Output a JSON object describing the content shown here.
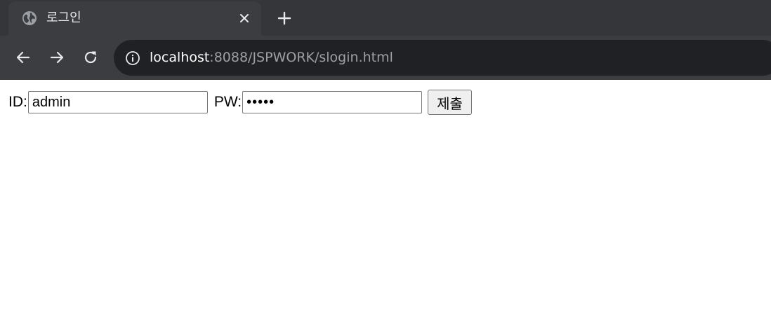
{
  "browser": {
    "tab": {
      "title": "로그인",
      "favicon": "globe-icon",
      "close": "close-icon"
    },
    "new_tab": "plus-icon",
    "toolbar": {
      "back": "arrow-left-icon",
      "forward": "arrow-right-icon",
      "reload": "reload-icon",
      "site_info": "info-icon",
      "url_host": "localhost",
      "url_rest": ":8088/JSPWORK/slogin.html"
    },
    "colors": {
      "tabstrip": "#35363a",
      "toolbar": "#3c3d40",
      "omnibox": "#202124",
      "url_dim": "#9aa0a6"
    }
  },
  "form": {
    "id_label": "ID:",
    "id_value": "admin",
    "pw_label": "PW:",
    "pw_value": "•••••",
    "submit_label": "제출"
  }
}
